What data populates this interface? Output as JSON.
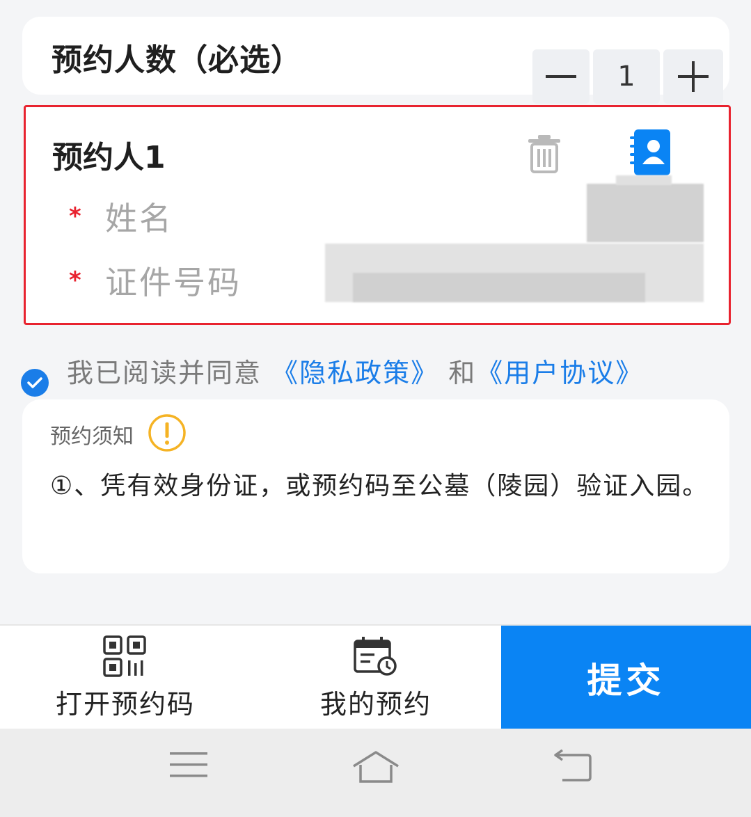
{
  "count": {
    "title": "预约人数（必选）",
    "minus": "—",
    "value": "1",
    "plus": "+"
  },
  "booker": {
    "title": "预约人1",
    "name_label": "姓名",
    "id_label": "证件号码",
    "required_mark": "*"
  },
  "agreement": {
    "prefix": "我已阅读并同意",
    "privacy_link": "《隐私政策》",
    "and": " 和",
    "terms_link": "《用户协议》",
    "checked": true
  },
  "notice": {
    "title": "预约须知",
    "body": "①、凭有效身份证，或预约码至公墓（陵园）验证入园。"
  },
  "bottom_bar": {
    "qrcode_label": "打开预约码",
    "mine_label": "我的预约",
    "submit_label": "提交"
  },
  "colors": {
    "accent": "#0a84f4",
    "required": "#e8232f",
    "link": "#1a7de8"
  }
}
